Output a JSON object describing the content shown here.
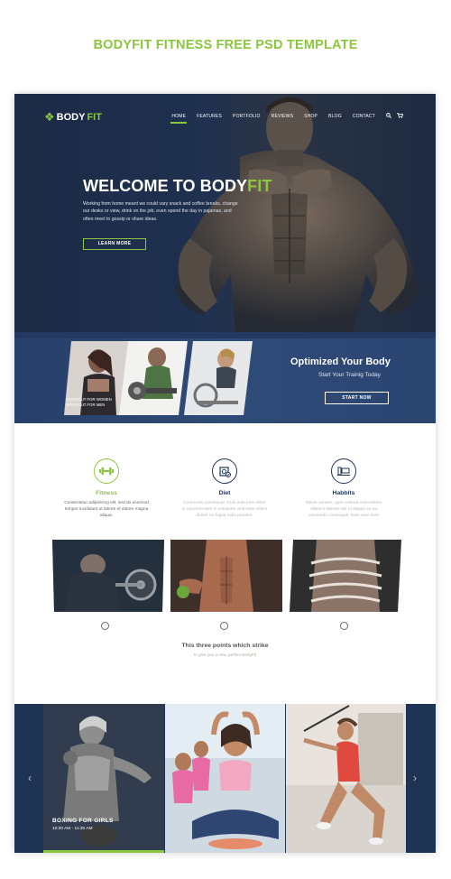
{
  "page_title": "BODYFIT FITNESS FREE PSD TEMPLATE",
  "header": {
    "logo_left": "BODY",
    "logo_right": "FIT",
    "nav": [
      "HOME",
      "FEATURES",
      "PORTFOLIO",
      "REVIEWS",
      "SHOP",
      "BLOG",
      "CONTACT"
    ],
    "active_nav": "HOME",
    "search_icon": "search-icon",
    "cart_icon": "cart-icon"
  },
  "hero": {
    "title_main": "WELCOME TO BODY",
    "title_accent": "FIT",
    "text": "Working from home meant we could vary snack and coffee breaks, change our desks or view, drink on the job, even spend the day in pajamas, and often meet to gossip or share ideas.",
    "button": "LEARN MORE"
  },
  "band": {
    "caption_line1": "WORKOUT FOR WOMEN",
    "caption_line2": "WORKOUT FOR MEN",
    "title": "Optimized Your Body",
    "subtitle": "Start Your Trainig Today",
    "button": "START NOW"
  },
  "features": [
    {
      "title": "Fitness",
      "desc": "Consectetur adipisicing elit, sed do eiusmod tempor incididunt ut labore et dolore magna aliqua.",
      "icon": "dumbbell-icon"
    },
    {
      "title": "Diet",
      "desc": "Commodo consequat. Duis aute irure dolor in reprehenderit in voluptate velit esse cillum dolore eu fugiat nulla pariatur.",
      "icon": "diet-plate-icon"
    },
    {
      "title": "Habbits",
      "desc": "Minim veniam, quis nostrud exercitation ullamco laboris nisi ut aliquip ex ea commodo consequat. Duis aute irure",
      "icon": "treadmill-icon"
    }
  ],
  "strike": {
    "title": "This three points which strike",
    "sub_prefix": "to give you a new, perfect Body",
    "sub_accent": "Fit"
  },
  "classes": {
    "title": "BOXING FOR GIRLS",
    "time": "10:30 AM - 11:30 AM"
  },
  "colors": {
    "accent": "#8cc63f",
    "navy": "#1f3354",
    "band": "#2f4b78"
  }
}
